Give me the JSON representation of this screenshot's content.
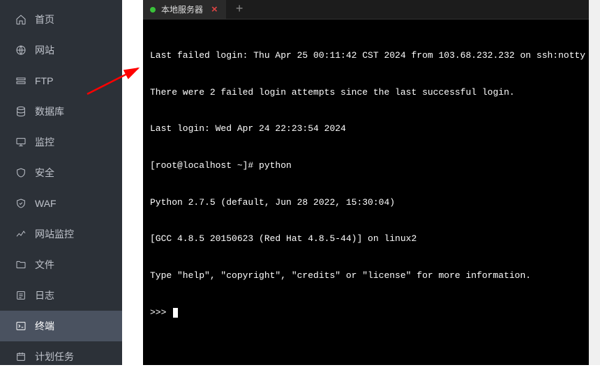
{
  "sidebar": {
    "items": [
      {
        "label": "首页",
        "icon": "home-icon"
      },
      {
        "label": "网站",
        "icon": "globe-icon"
      },
      {
        "label": "FTP",
        "icon": "ftp-icon"
      },
      {
        "label": "数据库",
        "icon": "database-icon"
      },
      {
        "label": "监控",
        "icon": "monitor-icon"
      },
      {
        "label": "安全",
        "icon": "shield-icon"
      },
      {
        "label": "WAF",
        "icon": "waf-icon"
      },
      {
        "label": "网站监控",
        "icon": "chart-icon"
      },
      {
        "label": "文件",
        "icon": "folder-icon"
      },
      {
        "label": "日志",
        "icon": "log-icon"
      },
      {
        "label": "终端",
        "icon": "terminal-icon",
        "active": true
      },
      {
        "label": "计划任务",
        "icon": "schedule-icon"
      }
    ]
  },
  "terminal": {
    "tab": {
      "title": "本地服务器"
    },
    "lines": [
      "Last failed login: Thu Apr 25 00:11:42 CST 2024 from 103.68.232.232 on ssh:notty",
      "There were 2 failed login attempts since the last successful login.",
      "Last login: Wed Apr 24 22:23:54 2024",
      "[root@localhost ~]# python",
      "Python 2.7.5 (default, Jun 28 2022, 15:30:04)",
      "[GCC 4.8.5 20150623 (Red Hat 4.8.5-44)] on linux2",
      "Type \"help\", \"copyright\", \"credits\" or \"license\" for more information.",
      ">>> "
    ]
  }
}
